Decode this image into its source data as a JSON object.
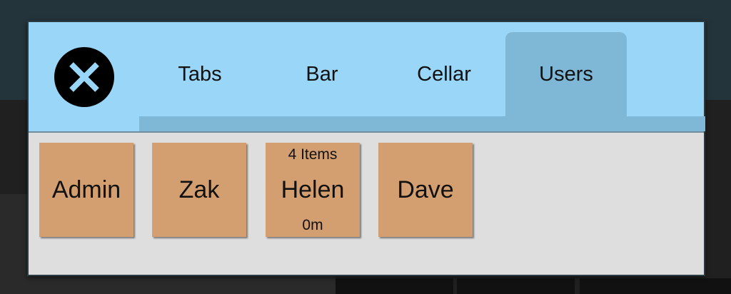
{
  "dialog": {
    "tabs": [
      {
        "label": "Tabs",
        "active": false
      },
      {
        "label": "Bar",
        "active": false
      },
      {
        "label": "Cellar",
        "active": false
      },
      {
        "label": "Users",
        "active": true
      }
    ],
    "close_icon": "close-icon"
  },
  "users": [
    {
      "name": "Admin"
    },
    {
      "name": "Zak"
    },
    {
      "name": "Helen",
      "items": "4 Items",
      "time": "0m"
    },
    {
      "name": "Dave"
    }
  ],
  "colors": {
    "header": "#9ad6f8",
    "active_tab": "#7fb7d6",
    "tile": "#d39f70",
    "content": "#dedede"
  }
}
